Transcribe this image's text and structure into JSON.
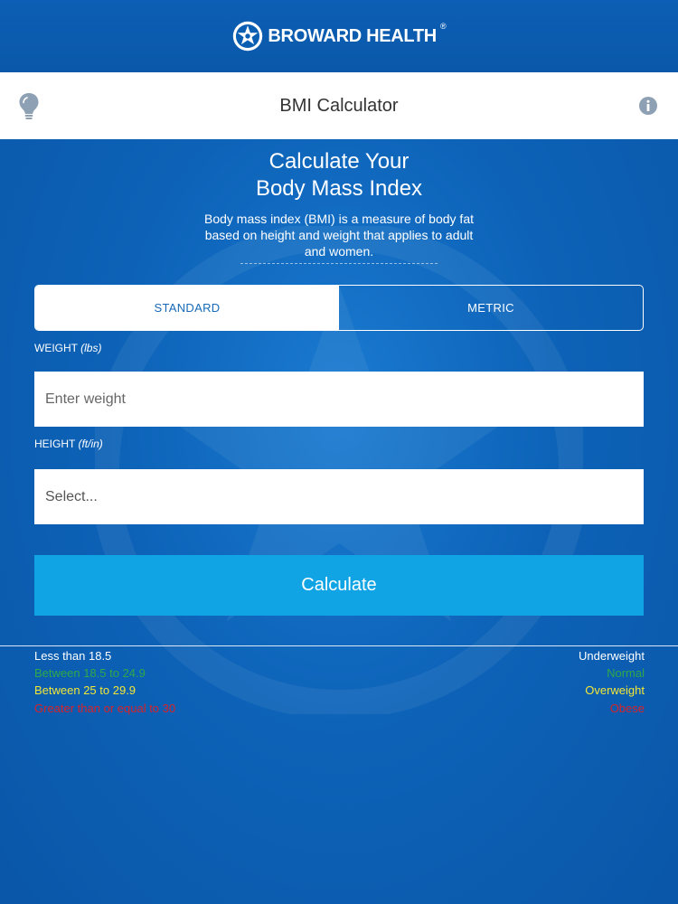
{
  "brand": {
    "name": "BROWARD HEALTH",
    "trademark": "®"
  },
  "titlebar": {
    "title": "BMI Calculator",
    "left_icon": "lightbulb-icon",
    "right_icon": "info-icon"
  },
  "intro": {
    "heading_line1": "Calculate Your",
    "heading_line2": "Body Mass Index",
    "description": "Body mass index (BMI) is a measure of body fat based on height and weight that applies to adult and women."
  },
  "units": {
    "tabs": [
      {
        "label": "STANDARD",
        "active": true
      },
      {
        "label": "METRIC",
        "active": false
      }
    ]
  },
  "weight": {
    "label": "WEIGHT",
    "unit": "(lbs)",
    "placeholder": "Enter weight",
    "value": ""
  },
  "height": {
    "label": "HEIGHT",
    "unit": "(ft/in)",
    "selected": "Select..."
  },
  "calculate_label": "Calculate",
  "legend": [
    {
      "range": "Less than 18.5",
      "category": "Underweight",
      "color": "#ffffff"
    },
    {
      "range": "Between 18.5 to 24.9",
      "category": "Normal",
      "color": "#2ea84a"
    },
    {
      "range": "Between 25 to 29.9",
      "category": "Overweight",
      "color": "#f2e636"
    },
    {
      "range": "Greater than or equal to 30",
      "category": "Obese",
      "color": "#d8232a"
    }
  ],
  "colors": {
    "brand_blue": "#0b5fb3",
    "button_blue": "#10a4e4",
    "white": "#ffffff"
  }
}
